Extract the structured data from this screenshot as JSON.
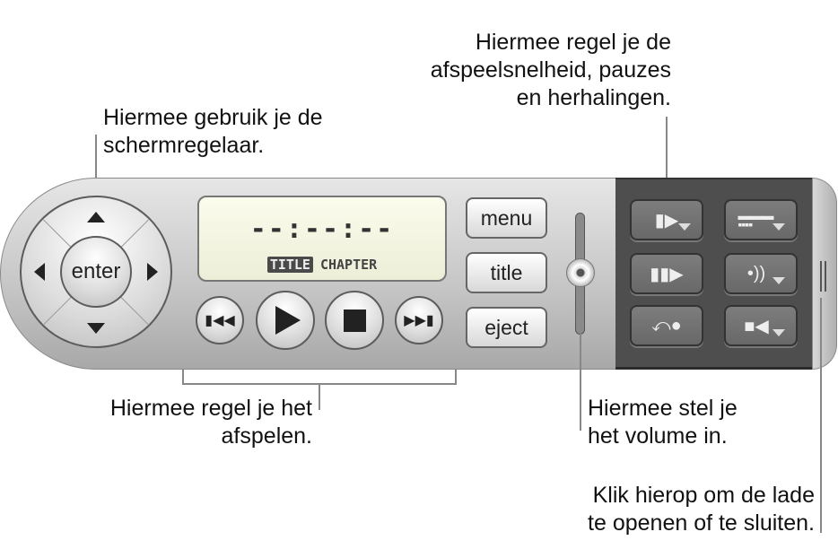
{
  "callouts": {
    "navigator": [
      "Hiermee gebruik je de",
      "schermregelaar."
    ],
    "playback_options": [
      "Hiermee regel je de",
      "afspeelsnelheid, pauzes",
      "en herhalingen."
    ],
    "playback": [
      "Hiermee regel je het",
      "afspelen."
    ],
    "volume": [
      "Hiermee stel je",
      "het volume in."
    ],
    "drawer": [
      "Klik hierop om de lade",
      "te openen of te sluiten."
    ]
  },
  "controller": {
    "enter_label": "enter",
    "display": {
      "time": "--:--:--",
      "title_tag": "TITLE",
      "chapter_tag": "CHAPTER"
    },
    "buttons": {
      "menu": "menu",
      "title": "title",
      "eject": "eject"
    },
    "transport_icons": [
      "previous-icon",
      "play-icon",
      "stop-icon",
      "next-icon"
    ],
    "drawer_icons": [
      "slow-motion-icon",
      "subtitles-icon",
      "step-frame-icon",
      "audio-icon",
      "return-icon",
      "angle-icon"
    ]
  }
}
